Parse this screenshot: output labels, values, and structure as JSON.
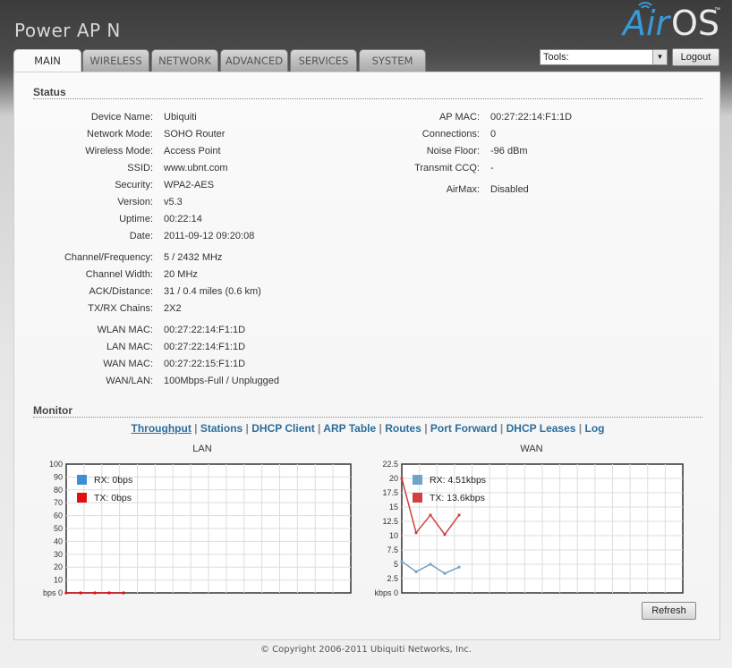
{
  "header": {
    "product_name": "Power AP N",
    "logo_air": "Air",
    "logo_os": "OS",
    "logo_tm": "™"
  },
  "tabs": [
    {
      "label": "MAIN",
      "active": true
    },
    {
      "label": "WIRELESS",
      "active": false
    },
    {
      "label": "NETWORK",
      "active": false
    },
    {
      "label": "ADVANCED",
      "active": false
    },
    {
      "label": "SERVICES",
      "active": false
    },
    {
      "label": "SYSTEM",
      "active": false
    }
  ],
  "toolbar": {
    "tools_value": "Tools:",
    "logout_label": "Logout"
  },
  "status": {
    "title": "Status",
    "left_group1": [
      {
        "label": "Device Name:",
        "value": "Ubiquiti"
      },
      {
        "label": "Network Mode:",
        "value": "SOHO Router"
      },
      {
        "label": "Wireless Mode:",
        "value": "Access Point"
      },
      {
        "label": "SSID:",
        "value": "www.ubnt.com"
      },
      {
        "label": "Security:",
        "value": "WPA2-AES"
      },
      {
        "label": "Version:",
        "value": "v5.3"
      },
      {
        "label": "Uptime:",
        "value": "00:22:14"
      },
      {
        "label": "Date:",
        "value": "2011-09-12 09:20:08"
      }
    ],
    "left_group2": [
      {
        "label": "Channel/Frequency:",
        "value": "5 / 2432 MHz"
      },
      {
        "label": "Channel Width:",
        "value": "20 MHz"
      },
      {
        "label": "ACK/Distance:",
        "value": "31 / 0.4 miles (0.6 km)"
      },
      {
        "label": "TX/RX Chains:",
        "value": "2X2"
      }
    ],
    "left_group3": [
      {
        "label": "WLAN MAC:",
        "value": "00:27:22:14:F1:1D"
      },
      {
        "label": "LAN MAC:",
        "value": "00:27:22:14:F1:1D"
      },
      {
        "label": "WAN MAC:",
        "value": "00:27:22:15:F1:1D"
      },
      {
        "label": "WAN/LAN:",
        "value": "100Mbps-Full / Unplugged"
      }
    ],
    "right_group": [
      {
        "label": "AP MAC:",
        "value": "00:27:22:14:F1:1D"
      },
      {
        "label": "Connections:",
        "value": "0"
      },
      {
        "label": "Noise Floor:",
        "value": "-96 dBm"
      },
      {
        "label": "Transmit CCQ:",
        "value": "-"
      },
      {
        "label": "AirMax:",
        "value": "Disabled"
      }
    ]
  },
  "monitor": {
    "title": "Monitor",
    "links": [
      "Throughput",
      "Stations",
      "DHCP Client",
      "ARP Table",
      "Routes",
      "Port Forward",
      "DHCP Leases",
      "Log"
    ],
    "active_link": "Throughput",
    "separator": "|",
    "refresh_label": "Refresh"
  },
  "chart_data": [
    {
      "type": "line",
      "title": "LAN",
      "ylabel_unit": "bps",
      "ylim": [
        0,
        100
      ],
      "yticks": [
        "0",
        "10",
        "20",
        "30",
        "40",
        "50",
        "60",
        "70",
        "80",
        "90",
        "100"
      ],
      "grid": true,
      "legend_placement": "top-left",
      "x": [
        1,
        2,
        3,
        4,
        5
      ],
      "series": [
        {
          "name": "RX: 0bps",
          "color": "#3a8fd6",
          "values": [
            0,
            0,
            0,
            0,
            0
          ]
        },
        {
          "name": "TX: 0bps",
          "color": "#e01010",
          "values": [
            0,
            0,
            0,
            0,
            0
          ]
        }
      ]
    },
    {
      "type": "line",
      "title": "WAN",
      "ylabel_unit": "kbps",
      "ylim": [
        0,
        22.5
      ],
      "yticks": [
        "0",
        "2.5",
        "5",
        "7.5",
        "10",
        "12.5",
        "15",
        "17.5",
        "20",
        "22.5"
      ],
      "grid": true,
      "legend_placement": "top-left",
      "x": [
        1,
        2,
        3,
        4,
        5
      ],
      "series": [
        {
          "name": "RX: 4.51kbps",
          "color": "#6fa3c8",
          "values": [
            5.5,
            3.7,
            5.0,
            3.4,
            4.5
          ]
        },
        {
          "name": "TX: 13.6kbps",
          "color": "#d04040",
          "values": [
            20,
            10.5,
            13.6,
            10.2,
            13.6
          ]
        }
      ]
    }
  ],
  "footer": {
    "copyright": "© Copyright 2006-2011 Ubiquiti Networks, Inc."
  }
}
